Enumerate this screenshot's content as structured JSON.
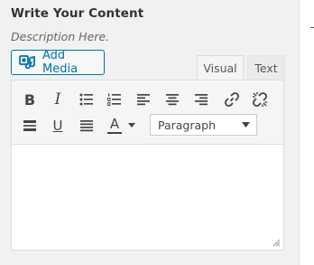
{
  "section": {
    "title": "Write Your Content",
    "description": "Description Here."
  },
  "media": {
    "add_label": "Add Media"
  },
  "tabs": [
    {
      "label": "Visual",
      "active": true
    },
    {
      "label": "Text",
      "active": false
    }
  ],
  "toolbar": {
    "row1": [
      "bold-icon",
      "italic-icon",
      "bulleted-list-icon",
      "numbered-list-icon",
      "align-left-icon",
      "align-center-icon",
      "align-right-icon",
      "insert-link-icon",
      "remove-link-icon"
    ],
    "row2": [
      "horizontal-line-icon",
      "underline-icon",
      "justify-icon",
      "text-color-icon",
      "text-color-dropdown-icon"
    ],
    "bold_glyph": "B",
    "italic_glyph": "I",
    "underline_glyph": "U",
    "textcolor_glyph": "A",
    "format_select": {
      "selected": "Paragraph"
    }
  },
  "editor": {
    "content": ""
  },
  "colors": {
    "accent": "#0073aa",
    "text": "#333333",
    "toolbar_bg": "#f5f5f5"
  }
}
